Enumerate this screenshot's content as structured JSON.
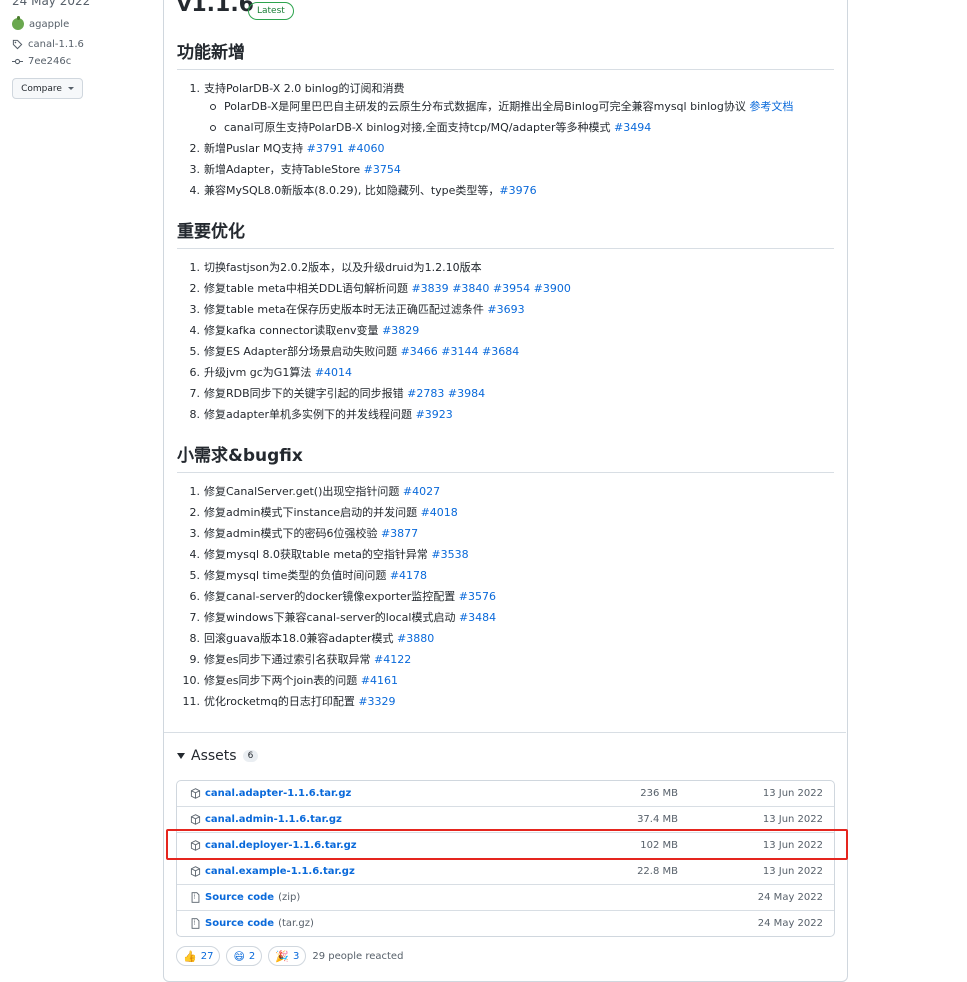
{
  "sidebar": {
    "date": "24 May 2022",
    "author": "agapple",
    "tag": "canal-1.1.6",
    "commit": "7ee246c",
    "compare_label": "Compare"
  },
  "release": {
    "version": "v1.1.6",
    "badge": "Latest"
  },
  "sections": {
    "features": {
      "title": "功能新增",
      "items": [
        {
          "text": "支持PolarDB-X 2.0 binlog的订阅和消费",
          "links": []
        },
        {
          "text": "PolarDB-X是阿里巴巴自主研发的云原生分布式数据库，近期推出全局Binlog可完全兼容mysql binlog协议",
          "links": [
            "参考文档"
          ]
        },
        {
          "text": "canal可原生支持PolarDB-X binlog对接,全面支持tcp/MQ/adapter等多种模式",
          "links": [
            "#3494"
          ]
        },
        {
          "text": "新增Puslar MQ支持",
          "links": [
            "#3791",
            "#4060"
          ]
        },
        {
          "text": "新增Adapter，支持TableStore",
          "links": [
            "#3754"
          ]
        },
        {
          "text": "兼容MySQL8.0新版本(8.0.29), 比如隐藏列、type类型等，",
          "links": [
            "#3976"
          ]
        }
      ]
    },
    "optimizations": {
      "title": "重要优化",
      "items": [
        {
          "text": "切换fastjson为2.0.2版本，以及升级druid为1.2.10版本",
          "links": []
        },
        {
          "text": "修复table meta中相关DDL语句解析问题",
          "links": [
            "#3839",
            "#3840",
            "#3954",
            "#3900"
          ]
        },
        {
          "text": "修复table meta在保存历史版本时无法正确匹配过滤条件",
          "links": [
            "#3693"
          ]
        },
        {
          "text": "修复kafka connector读取env变量",
          "links": [
            "#3829"
          ]
        },
        {
          "text": "修复ES Adapter部分场景启动失败问题",
          "links": [
            "#3466",
            "#3144",
            "#3684"
          ]
        },
        {
          "text": "升级jvm gc为G1算法",
          "links": [
            "#4014"
          ]
        },
        {
          "text": "修复RDB同步下的关键字引起的同步报错",
          "links": [
            "#2783",
            "#3984"
          ]
        },
        {
          "text": "修复adapter单机多实例下的并发线程问题",
          "links": [
            "#3923"
          ]
        }
      ]
    },
    "bugfix": {
      "title": "小需求&bugfix",
      "items": [
        {
          "text": "修复CanalServer.get()出现空指针问题",
          "links": [
            "#4027"
          ]
        },
        {
          "text": "修复admin模式下instance启动的并发问题",
          "links": [
            "#4018"
          ]
        },
        {
          "text": "修复admin模式下的密码6位强校验",
          "links": [
            "#3877"
          ]
        },
        {
          "text": "修复mysql 8.0获取table meta的空指针异常",
          "links": [
            "#3538"
          ]
        },
        {
          "text": "修复mysql time类型的负值时间问题",
          "links": [
            "#4178"
          ]
        },
        {
          "text": "修复canal-server的docker镜像exporter监控配置",
          "links": [
            "#3576"
          ]
        },
        {
          "text": "修复windows下兼容canal-server的local模式启动",
          "links": [
            "#3484"
          ]
        },
        {
          "text": "回滚guava版本18.0兼容adapter模式",
          "links": [
            "#3880"
          ]
        },
        {
          "text": "修复es同步下通过索引名获取异常",
          "links": [
            "#4122"
          ]
        },
        {
          "text": "修复es同步下两个join表的问题",
          "links": [
            "#4161"
          ]
        },
        {
          "text": "优化rocketmq的日志打印配置",
          "links": [
            "#3329"
          ]
        }
      ]
    }
  },
  "assets": {
    "title": "Assets",
    "count": "6",
    "rows": [
      {
        "name": "canal.adapter-1.1.6.tar.gz",
        "sub": "",
        "size": "236 MB",
        "date": "13 Jun 2022",
        "icon": "package-icon"
      },
      {
        "name": "canal.admin-1.1.6.tar.gz",
        "sub": "",
        "size": "37.4 MB",
        "date": "13 Jun 2022",
        "icon": "package-icon"
      },
      {
        "name": "canal.deployer-1.1.6.tar.gz",
        "sub": "",
        "size": "102 MB",
        "date": "13 Jun 2022",
        "icon": "package-icon"
      },
      {
        "name": "canal.example-1.1.6.tar.gz",
        "sub": "",
        "size": "22.8 MB",
        "date": "13 Jun 2022",
        "icon": "package-icon"
      },
      {
        "name": "Source code",
        "sub": "(zip)",
        "size": "",
        "date": "24 May 2022",
        "icon": "file-zip-icon"
      },
      {
        "name": "Source code",
        "sub": "(tar.gz)",
        "size": "",
        "date": "24 May 2022",
        "icon": "file-zip-icon"
      }
    ]
  },
  "reactions": {
    "items": [
      {
        "emoji": "👍",
        "count": "27"
      },
      {
        "emoji": "😄",
        "count": "2"
      },
      {
        "emoji": "🎉",
        "count": "3"
      }
    ],
    "summary": "29 people reacted"
  },
  "colors": {
    "link": "#0969da",
    "latest_badge": "#1a7f37",
    "highlight_box": "#e5251e"
  }
}
